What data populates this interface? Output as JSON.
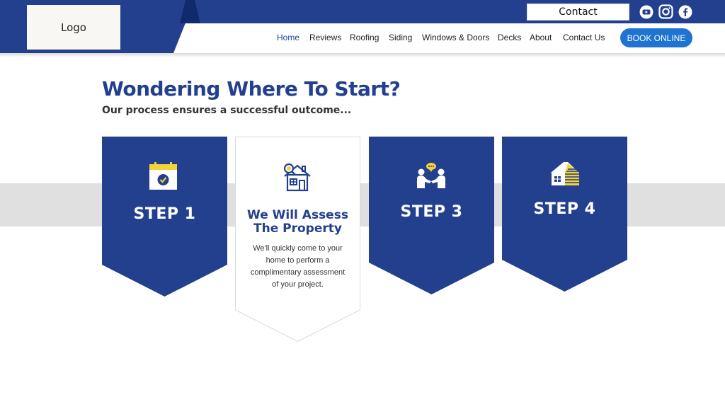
{
  "header": {
    "logo_text": "Logo",
    "contact_label": "Contact",
    "social": [
      "youtube-icon",
      "instagram-icon",
      "facebook-icon"
    ],
    "nav": [
      {
        "label": "Home",
        "active": true
      },
      {
        "label": "Reviews"
      },
      {
        "label": "Roofing"
      },
      {
        "label": "Siding"
      },
      {
        "label": "Windows & Doors"
      },
      {
        "label": "Decks"
      },
      {
        "label": "About"
      },
      {
        "label": "Contact Us"
      }
    ],
    "book_label": "BOOK ONLINE"
  },
  "main": {
    "title": "Wondering Where To Start?",
    "subtitle": "Our process ensures a successful outcome...",
    "steps": [
      {
        "label": "STEP 1",
        "icon": "calendar-check-icon"
      },
      {
        "title": "We Will Assess The Property",
        "text": "We'll quickly come to your home to perform a complimentary assessment of your project.",
        "icon": "house-search-icon"
      },
      {
        "label": "STEP 3",
        "icon": "handshake-chat-icon"
      },
      {
        "label": "STEP 4",
        "icon": "house-siding-icon"
      }
    ]
  },
  "colors": {
    "brand_blue": "#23408e",
    "button_blue": "#1f73d1",
    "accent_yellow": "#f2d33a",
    "band_gray": "#e0e0e0"
  }
}
